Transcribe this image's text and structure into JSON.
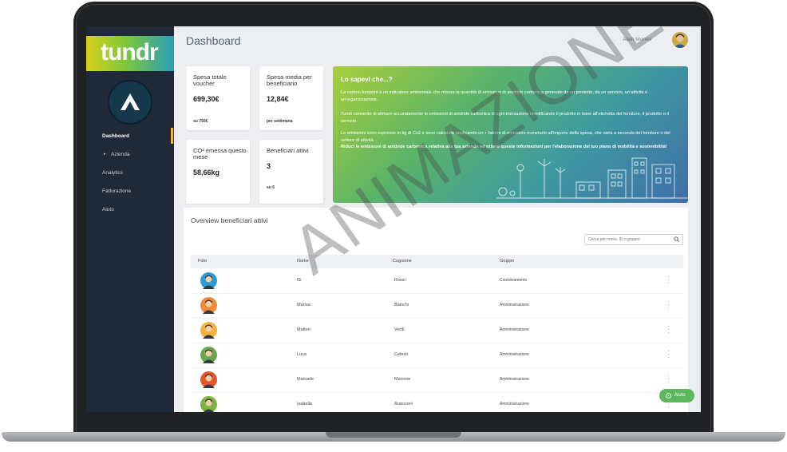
{
  "app": {
    "logo": "tundr"
  },
  "sidebar": {
    "items": [
      {
        "label": "Dashboard"
      },
      {
        "label": "Azienda",
        "prefix": "▸"
      },
      {
        "label": "Analytics"
      },
      {
        "label": "Fatturazione"
      },
      {
        "label": "Aiuto"
      }
    ]
  },
  "header": {
    "title": "Dashboard",
    "user_name": "Alain Moreni"
  },
  "cards": [
    {
      "title": "Spesa totale voucher",
      "value": "699,30€",
      "sub": "su 750€"
    },
    {
      "title": "Spesa media per beneficiario",
      "value": "12,84€",
      "sub": "per settimana"
    },
    {
      "title": "CO² emessa questo mese",
      "value": "58,66kg",
      "sub": ""
    },
    {
      "title": "Beneficiari attivi",
      "value": "3",
      "sub": "su 5"
    }
  ],
  "info": {
    "title": "Lo sapevi che...?",
    "p1": "La carbon footprint è un indicatore ambientale che misura la quantità di emissioni di anidride carbonica generate da un prodotto, da un servizio, un'attività o un'organizzazione.",
    "p2": "Tundr consente di stimare accuratamente le emissioni di anidride carbonica di ogni transazione identificando il prodotto in base all'etichetta del fornitore, il prodotto o il servizio.",
    "p3": "Le emissioni sono espresse in kg di Co2 e sono calcolate applicando un + fattore di emissioni monetario all'importo della spesa, che varia a seconda del fornitore o del settore di attività.",
    "p4": "Riduci le emissioni di anidride carbonica relativa alla tua azienda ed ottieni queste informazioni per l'elaborazione del tuo piano di mobilità e sostenibilità!"
  },
  "overview": {
    "title": "Overview beneficiari attivi",
    "search_placeholder": "Cerca per nome, ID o gruppo",
    "columns": [
      "Foto",
      "Nome",
      "Cognome",
      "Gruppo"
    ],
    "rows": [
      {
        "nome": "Gi",
        "cognome": "Rossi",
        "gruppo": "Coordinamento",
        "color": "#2a9bd6"
      },
      {
        "nome": "Marina",
        "cognome": "Bianchi",
        "gruppo": "Amministrazione",
        "color": "#f08a3c"
      },
      {
        "nome": "Matteo",
        "cognome": "Verdi",
        "gruppo": "Amministrazione",
        "color": "#f2b43a"
      },
      {
        "nome": "Luca",
        "cognome": "Celesti",
        "gruppo": "Amministrazione",
        "color": "#6aa84f"
      },
      {
        "nome": "Manuele",
        "cognome": "Marrone",
        "gruppo": "Amministrazione",
        "color": "#e4572e"
      },
      {
        "nome": "Isabella",
        "cognome": "Arancioni",
        "gruppo": "Amministrazione",
        "color": "#7cb342"
      }
    ]
  },
  "help": {
    "label": "Aiuto"
  },
  "watermark": "ANIMAZIONE",
  "colors": {
    "sidebar": "#1e2a38",
    "accent": "#f0b43a",
    "help": "#5cb85c"
  }
}
